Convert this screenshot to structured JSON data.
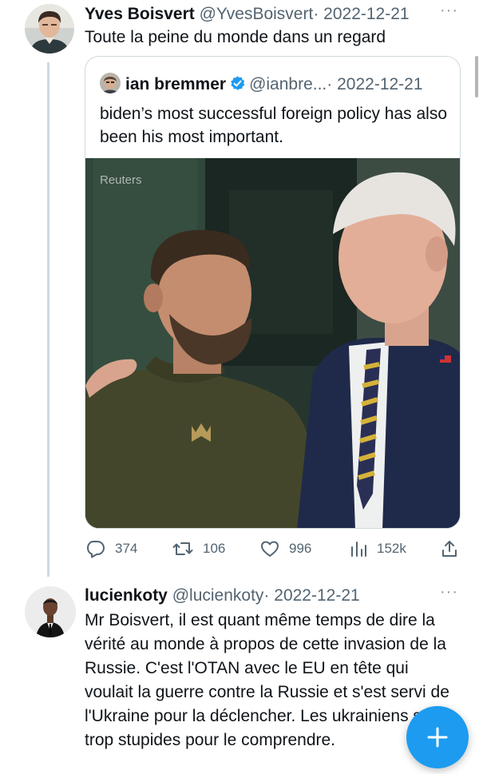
{
  "tweet1": {
    "name": "Yves Boisvert",
    "handle": "@YvesBoisvert",
    "separator": "·",
    "date": "2022-12-21",
    "more": "···",
    "text": "Toute la peine du monde dans un regard"
  },
  "quote": {
    "name": "ian bremmer",
    "handle": "@ianbre...",
    "separator": "·",
    "date": "2022-12-21",
    "text": "biden’s most successful foreign policy has also been his most important.",
    "photo_credit": "Reuters",
    "verified_icon": "verified-badge-icon"
  },
  "actions": {
    "replies": "374",
    "retweets": "106",
    "likes": "996",
    "views": "152k"
  },
  "tweet2": {
    "name": "lucienkoty",
    "handle": "@lucienkoty",
    "separator": "·",
    "date": "2022-12-21",
    "more": "···",
    "text": "Mr Boisvert, il est quant même temps de dire la vérité au monde à propos de cette invasion de la Russie. C'est l'OTAN avec le EU en tête qui voulait la guerre contre la Russie et s'est servi de l'Ukraine pour la déclencher. Les ukrainiens sont trop stupides pour le comprendre."
  },
  "colors": {
    "accent": "#1d9bf0",
    "muted": "#536471",
    "border": "#cfd9de"
  },
  "icons": {
    "compose": "plus-icon",
    "reply": "reply-icon",
    "retweet": "retweet-icon",
    "like": "heart-icon",
    "views": "views-icon",
    "share": "share-icon"
  }
}
